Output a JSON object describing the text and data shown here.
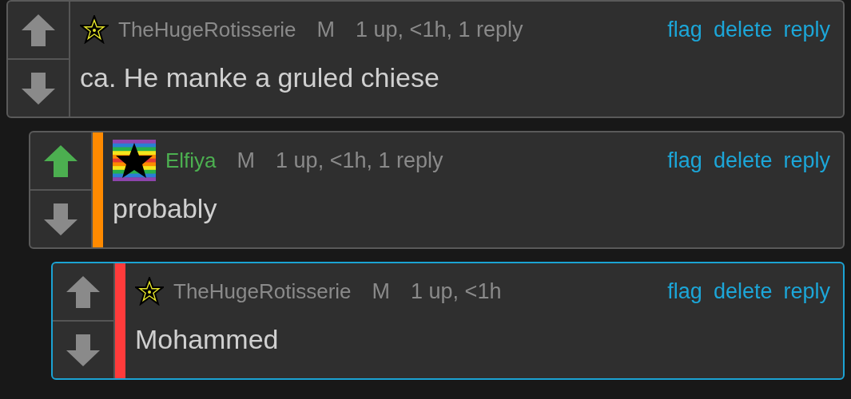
{
  "comments": [
    {
      "upvoted": false,
      "downvoted": false,
      "badge": {
        "kind": "star"
      },
      "user": {
        "name": "TheHugeRotisserie",
        "color": "#8a8a8a"
      },
      "gender": "M",
      "meta": "1 up, <1h, 1 reply",
      "actions": [
        "flag",
        "delete",
        "reply"
      ],
      "text": "ca. He manke a gruled chiese",
      "highlighted": false,
      "children": [
        {
          "upvoted": true,
          "downvoted": false,
          "thread": {
            "color": "#ff8a00"
          },
          "badge": {
            "kind": "rainbow-star"
          },
          "user": {
            "name": "Elfiya",
            "color": "#4caf50"
          },
          "gender": "M",
          "meta": "1 up, <1h, 1 reply",
          "actions": [
            "flag",
            "delete",
            "reply"
          ],
          "text": "probably",
          "highlighted": false,
          "children": [
            {
              "upvoted": false,
              "downvoted": false,
              "thread": {
                "color": "#ff3b3b"
              },
              "badge": {
                "kind": "star"
              },
              "user": {
                "name": "TheHugeRotisserie",
                "color": "#8a8a8a"
              },
              "gender": "M",
              "meta": "1 up, <1h",
              "actions": [
                "flag",
                "delete",
                "reply"
              ],
              "text": "Mohammed",
              "highlighted": true
            }
          ]
        }
      ]
    }
  ]
}
